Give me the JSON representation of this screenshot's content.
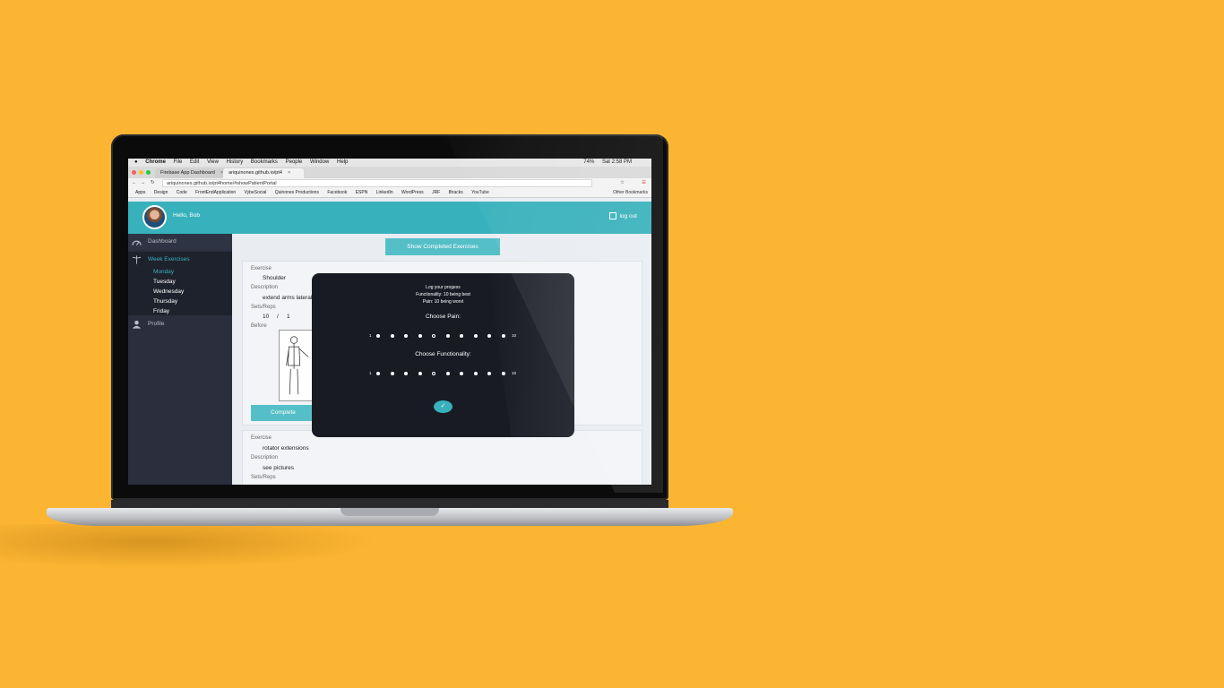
{
  "menubar": {
    "items": [
      "Chrome",
      "File",
      "Edit",
      "View",
      "History",
      "Bookmarks",
      "People",
      "Window",
      "Help"
    ],
    "battery": "74%",
    "clock": "Sat 2:58 PM"
  },
  "tabs": [
    "Firebase App Dashboard",
    "ariquinones.github.io/pt4"
  ],
  "address": "ariquinones.github.io/pt4home/#showPatientPortal",
  "bookmarks": [
    "Apps",
    "Design",
    "Code",
    "FrontEndApplication",
    "VybeSocial",
    "Quinones Productions",
    "Facebook",
    "ESPN",
    "LinkedIn",
    "WordPress",
    "JRF",
    "8tracks",
    "YouTube"
  ],
  "bookmarks_other": "Other Bookmarks",
  "header": {
    "greeting": "Hello, Bob",
    "logout": "log out"
  },
  "sidebar": {
    "dashboard": "Dashboard",
    "week": "Week Exercises",
    "days": [
      "Monday",
      "Tuesday",
      "Wednesday",
      "Thursday",
      "Friday"
    ],
    "profile": "Profile"
  },
  "main": {
    "show_completed": "Show Completed Exercises",
    "labels": {
      "exercise": "Exercise",
      "description": "Description",
      "sets": "Sets/Reps",
      "before": "Before"
    },
    "card1": {
      "exercise": "Shoulder",
      "description": "extend arms lateral",
      "sets": "10",
      "sep": "/",
      "reps": "1",
      "complete": "Complete"
    },
    "card2": {
      "exercise": "rotator extensions",
      "description": "see pictures"
    }
  },
  "modal": {
    "line1": "Log your progess",
    "line2": "Functionality: 10 being best",
    "line3": "Pain: 10 being worst",
    "pain_title": "Choose Pain:",
    "func_title": "Choose Functionality:",
    "scale_min": "1",
    "scale_max": "10",
    "pain_selected": 5,
    "func_selected": 5,
    "submit": "✓"
  },
  "colors": {
    "background": "#fbb532",
    "accent": "#37b1bb",
    "sidebar": "#2b2f3d",
    "modal": "#181b24"
  }
}
